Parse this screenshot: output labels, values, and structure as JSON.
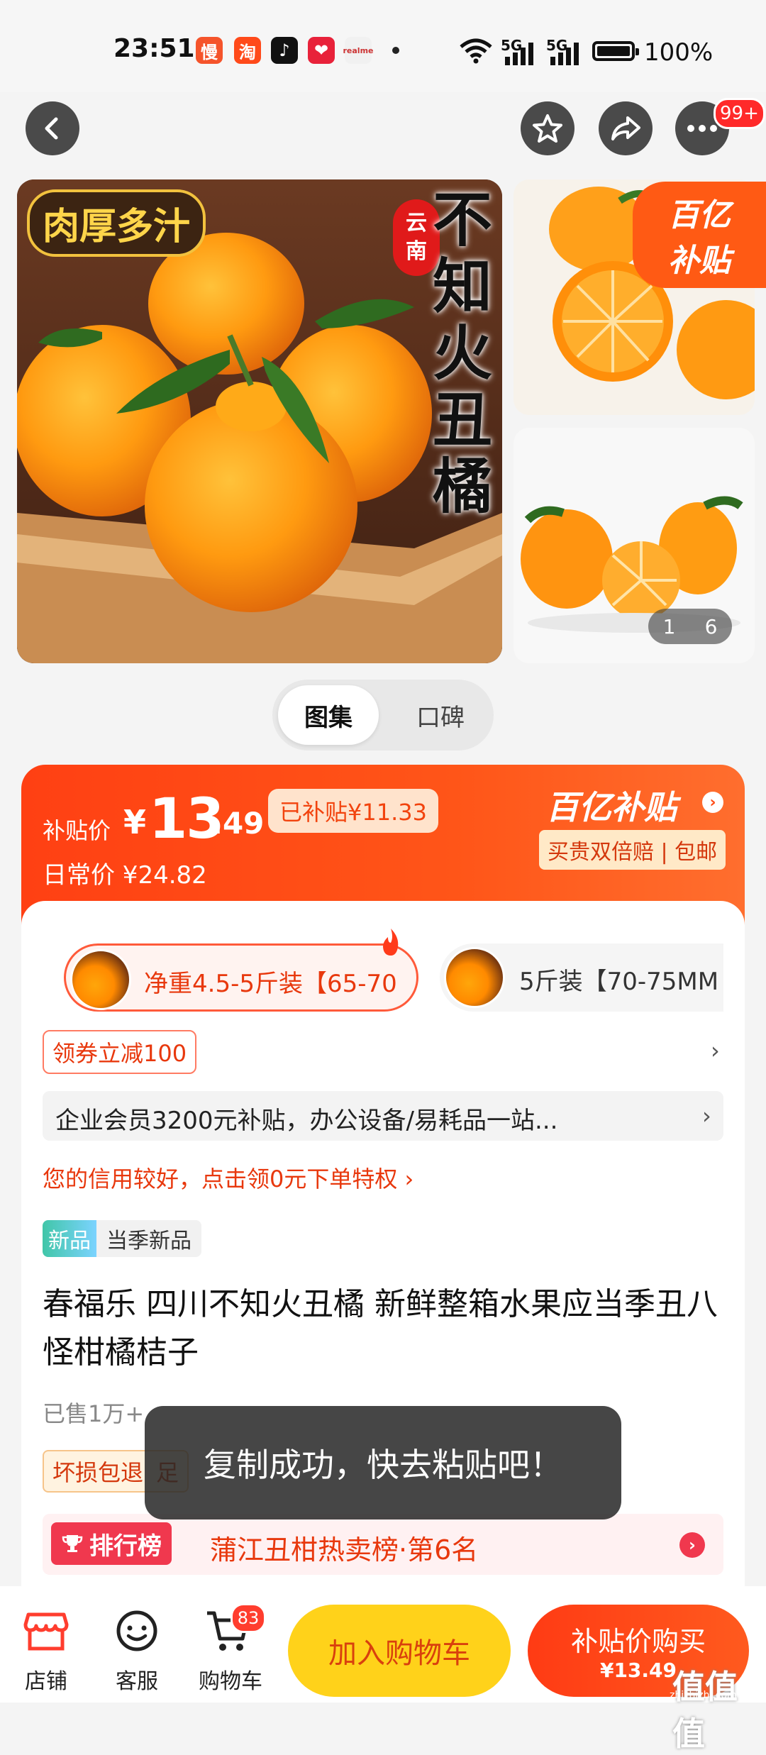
{
  "status_bar": {
    "time": "23:51",
    "app_icons": [
      {
        "name": "manman-app-icon",
        "glyph": "慢",
        "color": "#f5542b"
      },
      {
        "name": "taobao-app-icon",
        "glyph": "淘",
        "color": "#ff4a1a"
      },
      {
        "name": "tiktok-app-icon",
        "glyph": "♪",
        "color": "#111111"
      },
      {
        "name": "heart-app-icon",
        "glyph": "❤",
        "color": "#e8223a"
      },
      {
        "name": "realme-app-icon",
        "glyph": "realme",
        "color": "#f1f1f1"
      }
    ],
    "network_label_1": "5G",
    "network_label_2": "5G",
    "battery": "100%"
  },
  "nav": {
    "cart_badge": "99+"
  },
  "gallery": {
    "main_tag": "肉厚多汁",
    "origin_tag_line1": "云",
    "origin_tag_line2": "南",
    "vertical_title": "不知火丑橘",
    "subsidy_badge_line1": "百亿",
    "subsidy_badge_line2": "补贴",
    "page_current": "1",
    "page_total": "6"
  },
  "media_toggle": {
    "active": "图集",
    "inactive": "口碑"
  },
  "price": {
    "label": "补贴价",
    "currency": "¥",
    "integer": "13",
    "decimal": ".49",
    "subsidy_pill": "已补贴¥11.33",
    "daily_price": "日常价 ¥24.82",
    "brand": "百亿补贴",
    "guarantee": "买贵双倍赔 | 包邮"
  },
  "specs": [
    {
      "label": "净重4.5-5斤装【65-70",
      "selected": true
    },
    {
      "label": "5斤装【70-75MM",
      "selected": false
    }
  ],
  "coupon": "领券立减100",
  "enterprise": "企业会员3200元补贴，办公设备/易耗品一站...",
  "credit": "您的信用较好，点击领0元下单特权 ›",
  "new_tag": {
    "badge": "新品",
    "text": "当季新品"
  },
  "title": "春福乐 四川不知火丑橘 新鲜整箱水果应当季丑八怪柑橘桔子",
  "sold": "已售1万+",
  "loss_badge": "坏损包退",
  "loss_badge_hidden_suffix": "足",
  "ranking": {
    "badge": "排行榜",
    "text": "蒲江丑柑热卖榜·第6名"
  },
  "toast": "复制成功，快去粘贴吧！",
  "bottom_bar": {
    "shop": "店铺",
    "service": "客服",
    "cart": "购物车",
    "cart_count": "83",
    "add_to_cart": "加入购物车",
    "buy_label": "补贴价购买",
    "buy_price": "¥13.49"
  },
  "watermark": {
    "text": "值值值",
    "url": "zhizhizhi.com"
  },
  "colors": {
    "brand_orange": "#ff4a14",
    "add_cart_yellow": "#ffd21a",
    "rank_red": "#f0384e"
  }
}
